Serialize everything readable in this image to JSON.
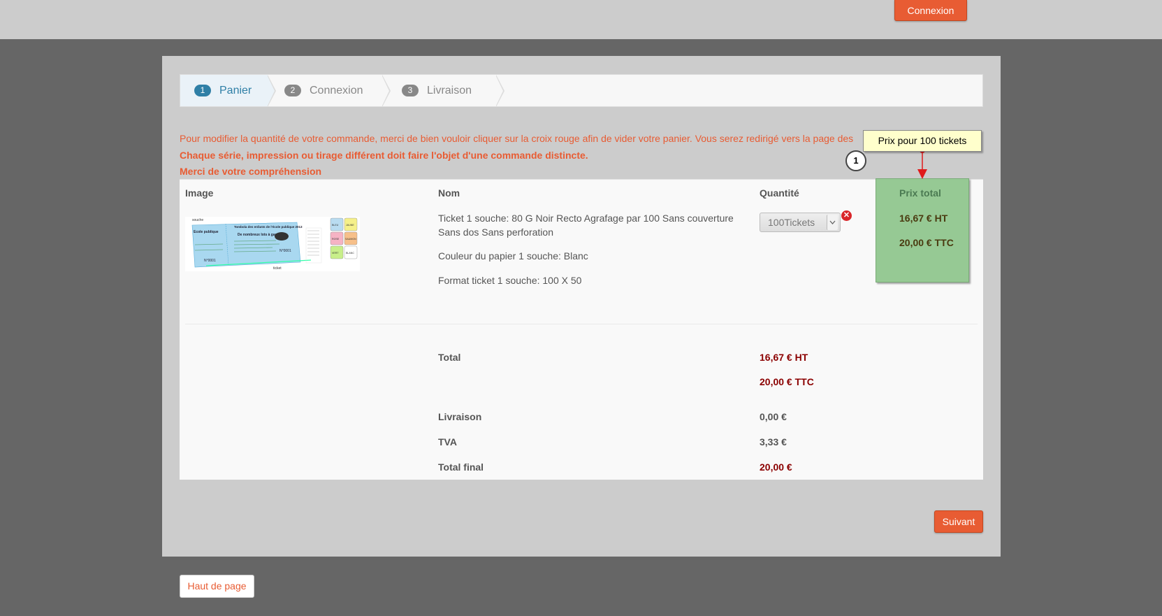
{
  "header": {
    "login_label": "Connexion"
  },
  "steps": [
    {
      "num": "1",
      "label": "Panier"
    },
    {
      "num": "2",
      "label": "Connexion"
    },
    {
      "num": "3",
      "label": "Livraison"
    }
  ],
  "notices": {
    "line1": "Pour modifier la quantité de votre commande, merci de bien vouloir cliquer sur la croix rouge afin de vider votre panier. Vous serez redirigé vers la page des",
    "line2": "Chaque série, impression ou tirage différent doit faire l'objet d'une commande distincte.",
    "line3": "Merci de votre compréhension"
  },
  "cart": {
    "headers": {
      "image": "Image",
      "name": "Nom",
      "quantity": "Quantité",
      "total": "Prix total"
    },
    "product": {
      "line1": "Ticket 1 souche: 80 G Noir Recto Agrafage par 100 Sans couverture",
      "line1b": "Sans dos Sans perforation",
      "line2": "Couleur du papier 1 souche: Blanc",
      "line3": "Format ticket 1 souche: 100 X 50",
      "quantity": "100Tickets",
      "price_ht": "16,67 € HT",
      "price_ttc": "20,00 € TTC"
    },
    "thumbnail": {
      "souche": "souche",
      "title": "Tombola des enfants de l'école publique 2013",
      "school": "Ecole publique",
      "subtitle": "De nombreux lots à gagner!",
      "number": "N°0001",
      "ticket": "ticket",
      "colors": [
        "BLEU",
        "JAUNE",
        "ROSE",
        "SAUMON",
        "VERT",
        "BLANC"
      ]
    },
    "summary": {
      "total_label": "Total",
      "total_ht": "16,67 € HT",
      "total_ttc": "20,00 € TTC",
      "delivery_label": "Livraison",
      "delivery_value": "0,00 €",
      "tva_label": "TVA",
      "tva_value": "3,33 €",
      "final_label": "Total final",
      "final_value": "20,00 €"
    }
  },
  "annotation": {
    "tooltip": "Prix pour 100 tickets",
    "callout": "1"
  },
  "actions": {
    "next": "Suivant",
    "top": "Haut de page"
  }
}
